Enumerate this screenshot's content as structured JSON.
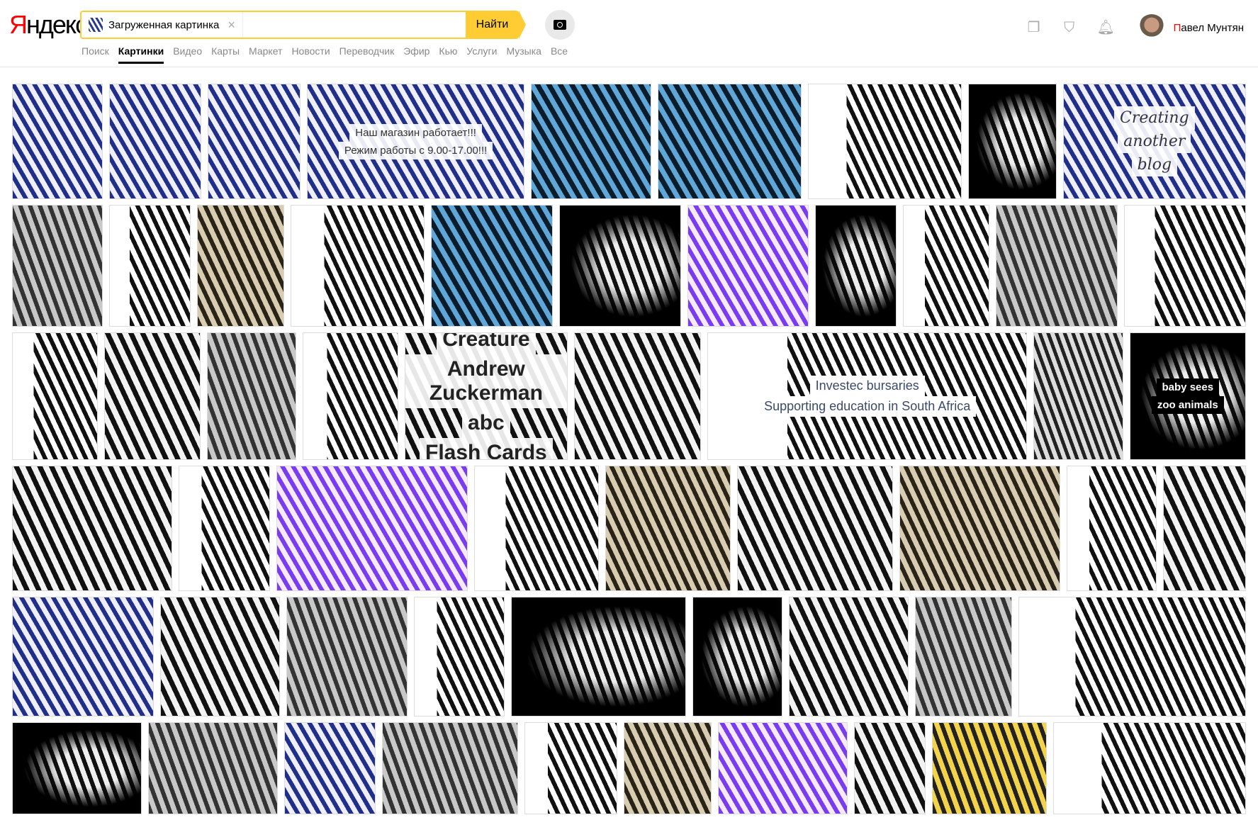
{
  "header": {
    "logo": {
      "first": "Я",
      "rest": "ндекс"
    },
    "search": {
      "chip_label": "Загруженная картинка",
      "clear": "×",
      "value": "",
      "find_label": "Найти"
    },
    "nav": [
      "Поиск",
      "Картинки",
      "Видео",
      "Карты",
      "Маркет",
      "Новости",
      "Переводчик",
      "Эфир",
      "Кью",
      "Услуги",
      "Музыка",
      "Все"
    ],
    "active_tab": "Картинки",
    "user": {
      "first": "П",
      "rest": "авел Мунтян"
    },
    "icons": [
      "collections-icon",
      "shield-icon",
      "bell-icon"
    ]
  },
  "results": {
    "captions": {
      "shop1": "Наш магазин работает!!!",
      "shop2": "Режим работы с 9.00-17.00!!!",
      "blog1": "Creating",
      "blog2": "another",
      "blog3": "blog",
      "creature": "Creature",
      "creature_author": "Andrew Zuckerman",
      "abc": "abc",
      "flash": "Flash Cards",
      "investec": "Investec bursaries",
      "investec_sub": "Supporting education in South Africa",
      "baby": "baby sees",
      "zoo": "zoo animals"
    }
  }
}
